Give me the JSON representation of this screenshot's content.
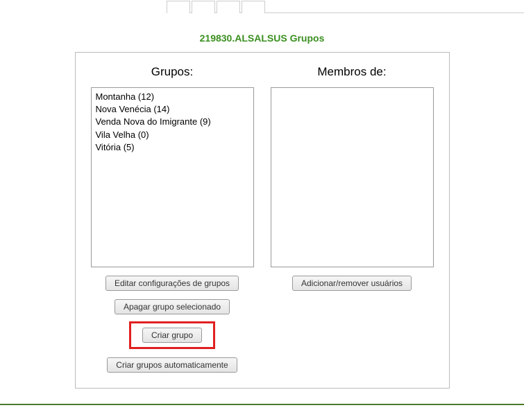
{
  "title": "219830.ALSALSUS Grupos",
  "columns": {
    "groups": {
      "label": "Grupos:",
      "items": [
        "Montanha (12)",
        "Nova Venécia (14)",
        "Venda Nova do Imigrante (9)",
        "Vila Velha (0)",
        "Vitória (5)"
      ],
      "buttons": {
        "edit_config": "Editar configurações de grupos",
        "delete_selected": "Apagar grupo selecionado",
        "create_group": "Criar grupo",
        "create_auto": "Criar grupos automaticamente"
      }
    },
    "members": {
      "label": "Membros de:",
      "items": [],
      "buttons": {
        "add_remove": "Adicionar/remover usuários"
      }
    }
  }
}
